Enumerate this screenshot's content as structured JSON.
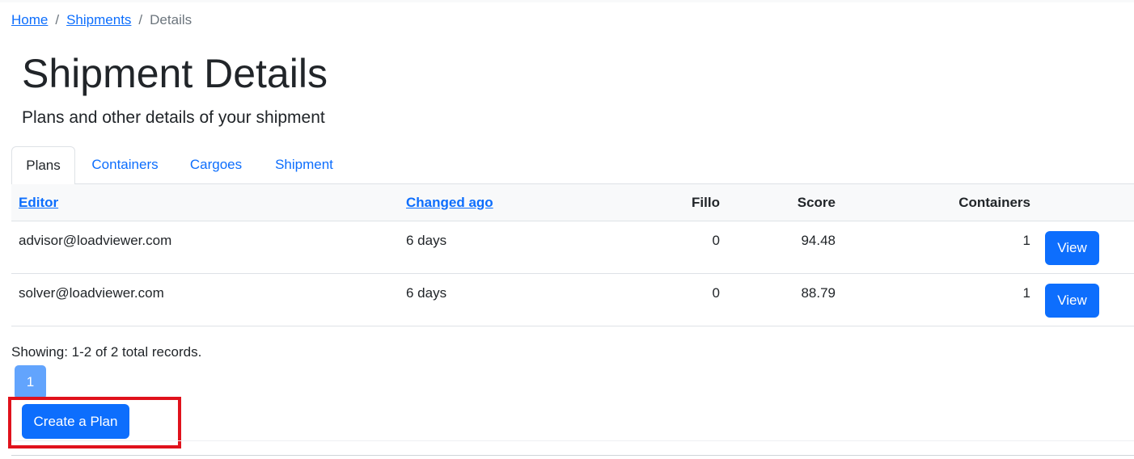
{
  "breadcrumb": {
    "home": "Home",
    "separator": "/",
    "shipments": "Shipments",
    "current": "Details"
  },
  "header": {
    "title": "Shipment Details",
    "subtitle": "Plans and other details of your shipment"
  },
  "tabs": [
    {
      "label": "Plans",
      "active": true
    },
    {
      "label": "Containers",
      "active": false
    },
    {
      "label": "Cargoes",
      "active": false
    },
    {
      "label": "Shipment",
      "active": false
    }
  ],
  "table": {
    "headers": {
      "editor": "Editor",
      "changed": "Changed ago",
      "fillo": "Fillo",
      "score": "Score",
      "containers": "Containers"
    },
    "rows": [
      {
        "editor": "advisor@loadviewer.com",
        "changed": "6 days",
        "fillo": "0",
        "score": "94.48",
        "containers": "1",
        "action": "View"
      },
      {
        "editor": "solver@loadviewer.com",
        "changed": "6 days",
        "fillo": "0",
        "score": "88.79",
        "containers": "1",
        "action": "View"
      }
    ]
  },
  "pagination": {
    "summary": "Showing: 1-2 of 2 total records.",
    "current_page": "1"
  },
  "actions": {
    "create_plan": "Create a Plan"
  },
  "colors": {
    "accent": "#0d6efd",
    "highlight_box": "#e0121c"
  }
}
